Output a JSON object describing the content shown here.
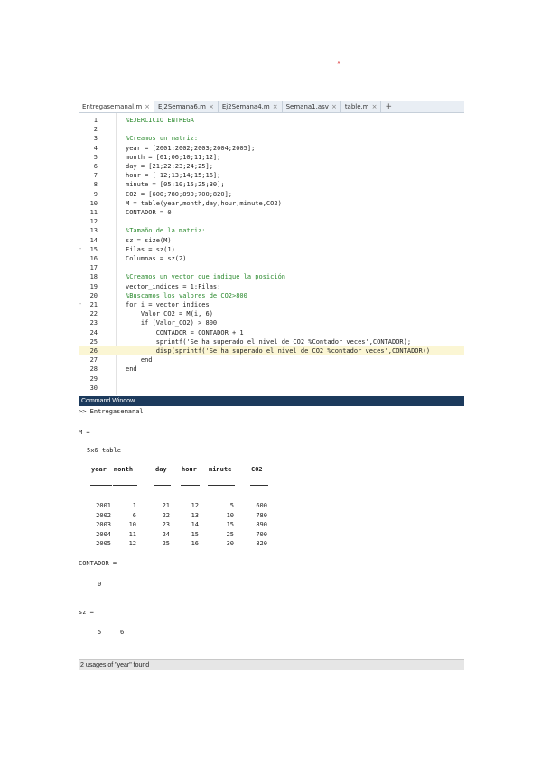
{
  "mark": "*",
  "tabs": [
    {
      "label": "Entregasemanal.m",
      "active": true
    },
    {
      "label": "Ej2Semana6.m",
      "active": false
    },
    {
      "label": "Ej2Semana4.m",
      "active": false
    },
    {
      "label": "Semana1.asv",
      "active": false
    },
    {
      "label": "table.m",
      "active": false
    }
  ],
  "tab_close_glyph": "×",
  "tab_add_glyph": "+",
  "editor": {
    "gutter_marks": [
      "-",
      "-"
    ],
    "lines": [
      {
        "n": "1",
        "text": "%EJERCICIO ENTREGA",
        "type": "comment"
      },
      {
        "n": "2",
        "text": "",
        "type": "code"
      },
      {
        "n": "3",
        "text": "%Creamos un matriz:",
        "type": "comment"
      },
      {
        "n": "4",
        "text": "year = [2001;2002;2003;2004;2005];",
        "type": "code"
      },
      {
        "n": "5",
        "text": "month = [01;06;10;11;12];",
        "type": "code"
      },
      {
        "n": "6",
        "text": "day = [21;22;23;24;25];",
        "type": "code"
      },
      {
        "n": "7",
        "text": "hour = [ 12;13;14;15;16];",
        "type": "code"
      },
      {
        "n": "8",
        "text": "minute = [05;10;15;25;30];",
        "type": "code"
      },
      {
        "n": "9",
        "text": "CO2 = [600;780;890;700;820];",
        "type": "code"
      },
      {
        "n": "10",
        "text": "M = table(year,month,day,hour,minute,CO2)",
        "type": "code"
      },
      {
        "n": "11",
        "text": "CONTADOR = 0",
        "type": "code"
      },
      {
        "n": "12",
        "text": "",
        "type": "code"
      },
      {
        "n": "13",
        "text": "%Tamaño de la matriz:",
        "type": "comment"
      },
      {
        "n": "14",
        "text": "sz = size(M)",
        "type": "code"
      },
      {
        "n": "15",
        "text": "Filas = sz(1)",
        "type": "code"
      },
      {
        "n": "16",
        "text": "Columnas = sz(2)",
        "type": "code"
      },
      {
        "n": "17",
        "text": "",
        "type": "code"
      },
      {
        "n": "18",
        "text": "%Creamos un vector que indique la posición",
        "type": "comment"
      },
      {
        "n": "19",
        "text": "vector_indices = 1:Filas;",
        "type": "code"
      },
      {
        "n": "20",
        "text": "%Buscamos los valores de CO2>800",
        "type": "comment"
      },
      {
        "n": "21",
        "text": "for i = vector_indices",
        "type": "code"
      },
      {
        "n": "22",
        "text": "    Valor_CO2 = M(i, 6)",
        "type": "code"
      },
      {
        "n": "23",
        "text": "    if (Valor_CO2) > 800",
        "type": "code"
      },
      {
        "n": "24",
        "text": "        CONTADOR = CONTADOR + 1",
        "type": "code"
      },
      {
        "n": "25",
        "text": "        sprintf('Se ha superado el nivel de CO2 %Contador veces',CONTADOR);",
        "type": "code"
      },
      {
        "n": "26",
        "text": "        disp(sprintf('Se ha superado el nivel de CO2 %contador veces',CONTADOR))",
        "type": "code",
        "highlight": true
      },
      {
        "n": "27",
        "text": "    end",
        "type": "code"
      },
      {
        "n": "28",
        "text": "end",
        "type": "code"
      },
      {
        "n": "29",
        "text": "",
        "type": "code"
      },
      {
        "n": "30",
        "text": "",
        "type": "code"
      }
    ]
  },
  "command_window": {
    "title": "Command Window",
    "prompt_line": ">> Entregasemanal",
    "m_label": "M =",
    "table_desc": "5x6 table",
    "headers": [
      "year",
      "month",
      "day",
      "hour",
      "minute",
      "CO2"
    ],
    "rows": [
      [
        "2001",
        "1",
        "21",
        "12",
        "5",
        "600"
      ],
      [
        "2002",
        "6",
        "22",
        "13",
        "10",
        "780"
      ],
      [
        "2003",
        "10",
        "23",
        "14",
        "15",
        "890"
      ],
      [
        "2004",
        "11",
        "24",
        "15",
        "25",
        "700"
      ],
      [
        "2005",
        "12",
        "25",
        "16",
        "30",
        "820"
      ]
    ],
    "contador_label": "CONTADOR =",
    "contador_value": "0",
    "sz_label": "sz =",
    "sz_values": [
      "5",
      "6"
    ]
  },
  "status_bar": {
    "text": "2 usages of \"year\" found"
  }
}
